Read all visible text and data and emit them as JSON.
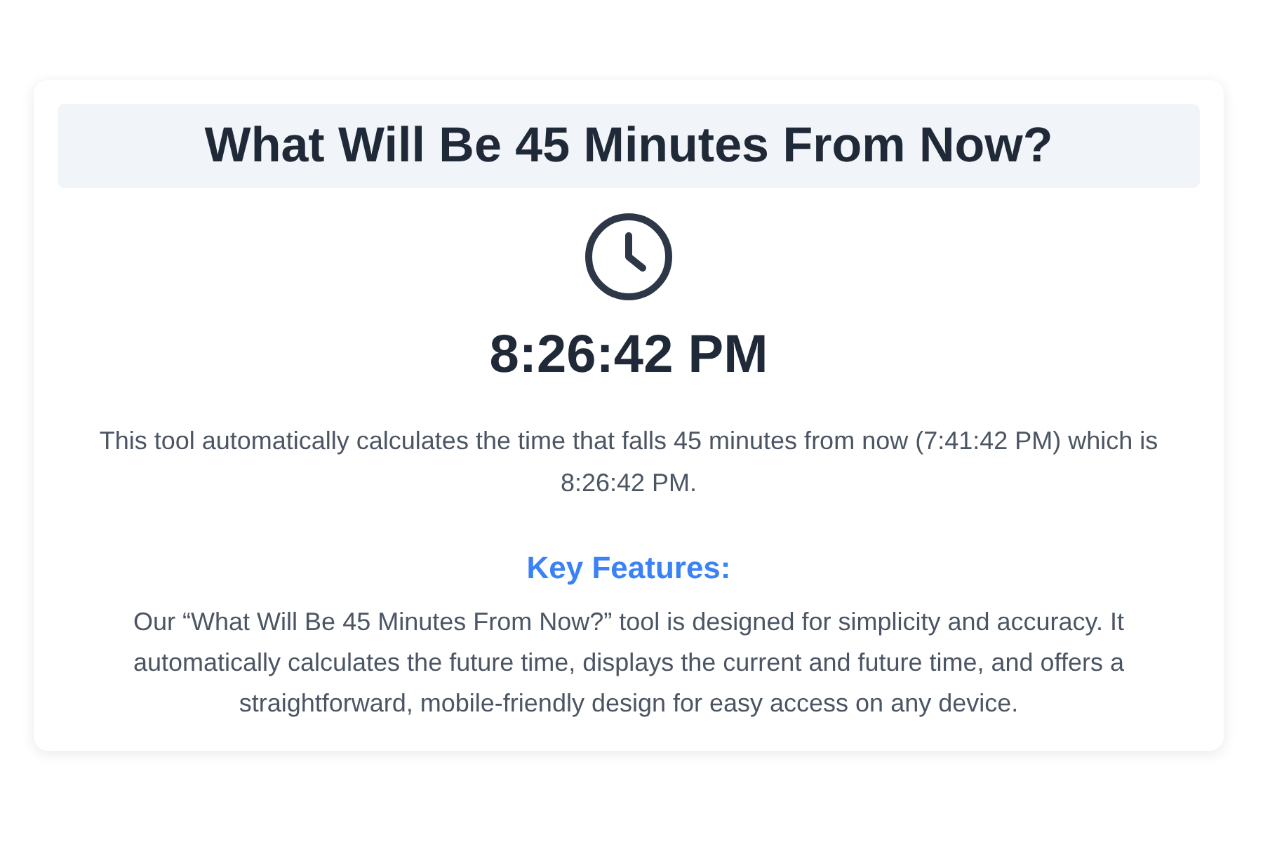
{
  "title": "What Will Be 45 Minutes From Now?",
  "result": {
    "time": "8:26:42 PM",
    "description": "This tool automatically calculates the time that falls 45 minutes from now (7:41:42 PM) which is 8:26:42 PM."
  },
  "key_features": {
    "heading": "Key Features:",
    "text": "Our “What Will Be 45 Minutes From Now?” tool is designed for simplicity and accuracy. It automatically calculates the future time, displays the current and future time, and offers a straightforward, mobile-friendly design for easy access on any device."
  }
}
